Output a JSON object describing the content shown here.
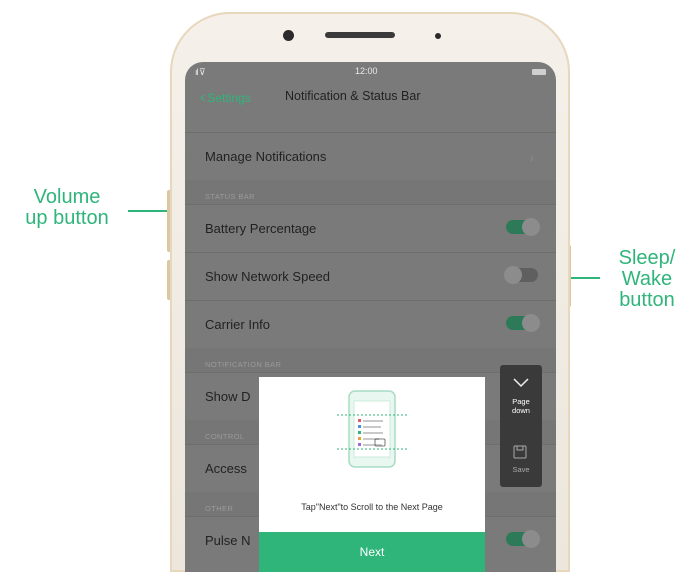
{
  "callouts": {
    "left_line1": "Volume",
    "left_line2": "up button",
    "right_line1": "Sleep/",
    "right_line2": "Wake",
    "right_line3": "button"
  },
  "status_bar": {
    "time": "12:00",
    "signal": "ıl ⊽"
  },
  "nav": {
    "back_label": "Settings",
    "title": "Notification & Status Bar"
  },
  "list": {
    "manage": "Manage Notifications",
    "section_status": "STATUS BAR",
    "battery": "Battery Percentage",
    "battery_on": true,
    "network": "Show Network Speed",
    "network_on": false,
    "carrier": "Carrier Info",
    "carrier_on": true,
    "section_notification": "NOTIFICATION BAR",
    "show_d": "Show D",
    "section_control": "CONTROL",
    "access": "Access",
    "section_other": "OTHER",
    "pulse": "Pulse N"
  },
  "dialog": {
    "text": "Tap\"Next\"to Scroll to the Next Page",
    "next": "Next"
  },
  "side_panel": {
    "page_down_line1": "Page",
    "page_down_line2": "down",
    "save": "Save"
  },
  "colors": {
    "accent": "#2fb57a"
  }
}
